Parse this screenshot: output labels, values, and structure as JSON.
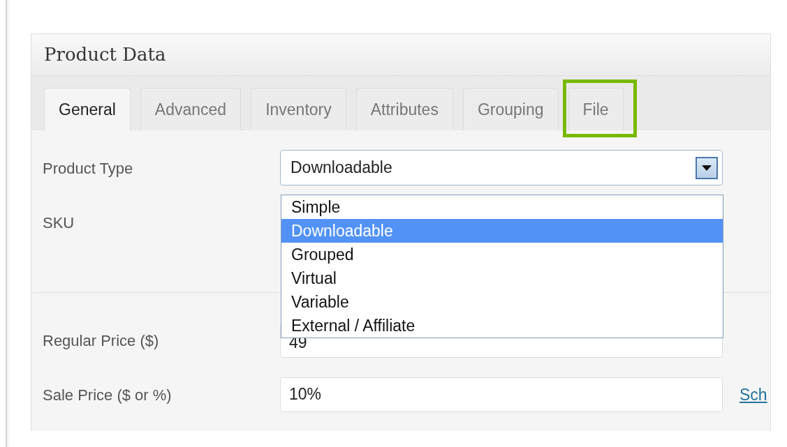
{
  "panel": {
    "title": "Product Data"
  },
  "tabs": [
    {
      "label": "General",
      "selected": true,
      "highlighted": false
    },
    {
      "label": "Advanced",
      "selected": false,
      "highlighted": false
    },
    {
      "label": "Inventory",
      "selected": false,
      "highlighted": false
    },
    {
      "label": "Attributes",
      "selected": false,
      "highlighted": false
    },
    {
      "label": "Grouping",
      "selected": false,
      "highlighted": false
    },
    {
      "label": "File",
      "selected": false,
      "highlighted": true
    }
  ],
  "product_type": {
    "label": "Product Type",
    "value": "Downloadable",
    "expanded": true,
    "options": [
      {
        "label": "Simple",
        "selected": false
      },
      {
        "label": "Downloadable",
        "selected": true
      },
      {
        "label": "Grouped",
        "selected": false
      },
      {
        "label": "Virtual",
        "selected": false
      },
      {
        "label": "Variable",
        "selected": false
      },
      {
        "label": "External / Affiliate",
        "selected": false
      }
    ]
  },
  "sku": {
    "label": "SKU"
  },
  "regular_price": {
    "label": "Regular Price ($)",
    "value": "49"
  },
  "sale_price": {
    "label": "Sale Price ($ or %)",
    "value": "10%",
    "link": "Sch"
  }
}
